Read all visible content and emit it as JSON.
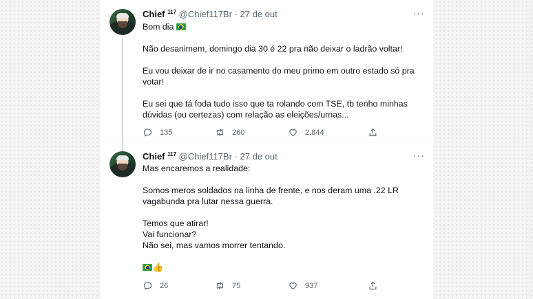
{
  "tweets": [
    {
      "author_name": "Chief",
      "author_badge": "117",
      "handle": "@Chief117Br",
      "separator": "·",
      "date": "27 de out",
      "more": "···",
      "paragraphs": [
        "Bom dia",
        "Não desanimem, domingo dia 30 é 22 pra não deixar o ladrão voltar!",
        "Eu vou deixar de ir no casamento do meu primo em outro estado só pra votar!",
        "Eu sei que tá foda tudo isso que ta rolando com TSE, tb tenho minhas dúvidas (ou certezas) com relação as eleições/urnas..."
      ],
      "replies": "135",
      "retweets": "260",
      "likes": "2.844"
    },
    {
      "author_name": "Chief",
      "author_badge": "117",
      "handle": "@Chief117Br",
      "separator": "·",
      "date": "27 de out",
      "more": "···",
      "paragraphs": [
        "Mas encaremos a realidade:",
        "Somos meros soldados na linha de frente, e nos deram uma .22 LR vagabunda pra lutar nessa guerra.",
        "Temos que atirar!",
        "Vai funcionar?",
        "Não sei, mas vamos morrer tentando."
      ],
      "emoji_line": "👍",
      "replies": "26",
      "retweets": "75",
      "likes": "937"
    }
  ],
  "icons": {
    "reply": "reply-icon",
    "retweet": "retweet-icon",
    "like": "heart-icon",
    "share": "share-icon",
    "flag": "brazil-flag-icon"
  }
}
